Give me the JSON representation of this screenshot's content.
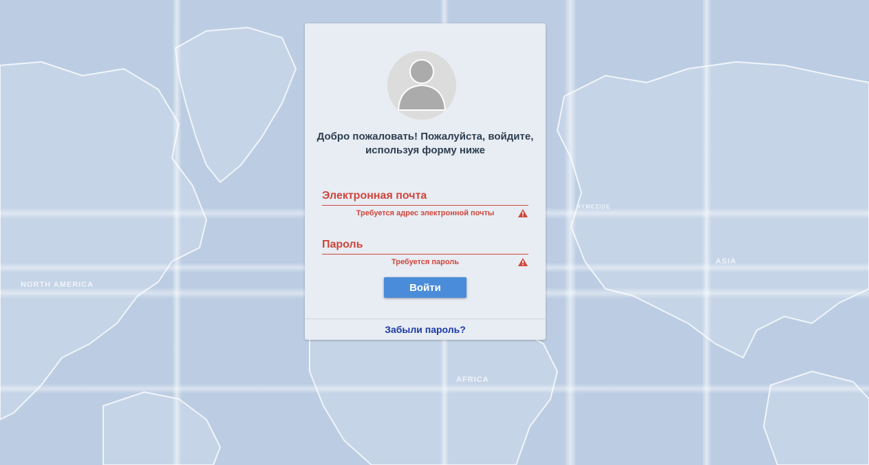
{
  "background": {
    "map_labels": [
      "NORTH AMERICA",
      "AFRICA",
      "ASIA",
      "NYMEZIDE"
    ]
  },
  "login": {
    "avatar_icon": "user-placeholder-icon",
    "welcome_text": "Добро пожаловать! Пожалуйста, войдите, используя форму ниже",
    "email": {
      "label": "Электронная почта",
      "error": "Требуется адрес электронной почты",
      "error_icon": "warning-icon"
    },
    "password": {
      "label": "Пароль",
      "error": "Требуется пароль",
      "error_icon": "warning-icon"
    },
    "submit_label": "Войти",
    "forgot_password": "Забыли пароль?"
  },
  "colors": {
    "background": "#bccde3",
    "card": "#e8ecf3",
    "error": "#d0453a",
    "button": "#4a8cd9",
    "link": "#1a3aa5",
    "heading": "#2c3e50"
  }
}
